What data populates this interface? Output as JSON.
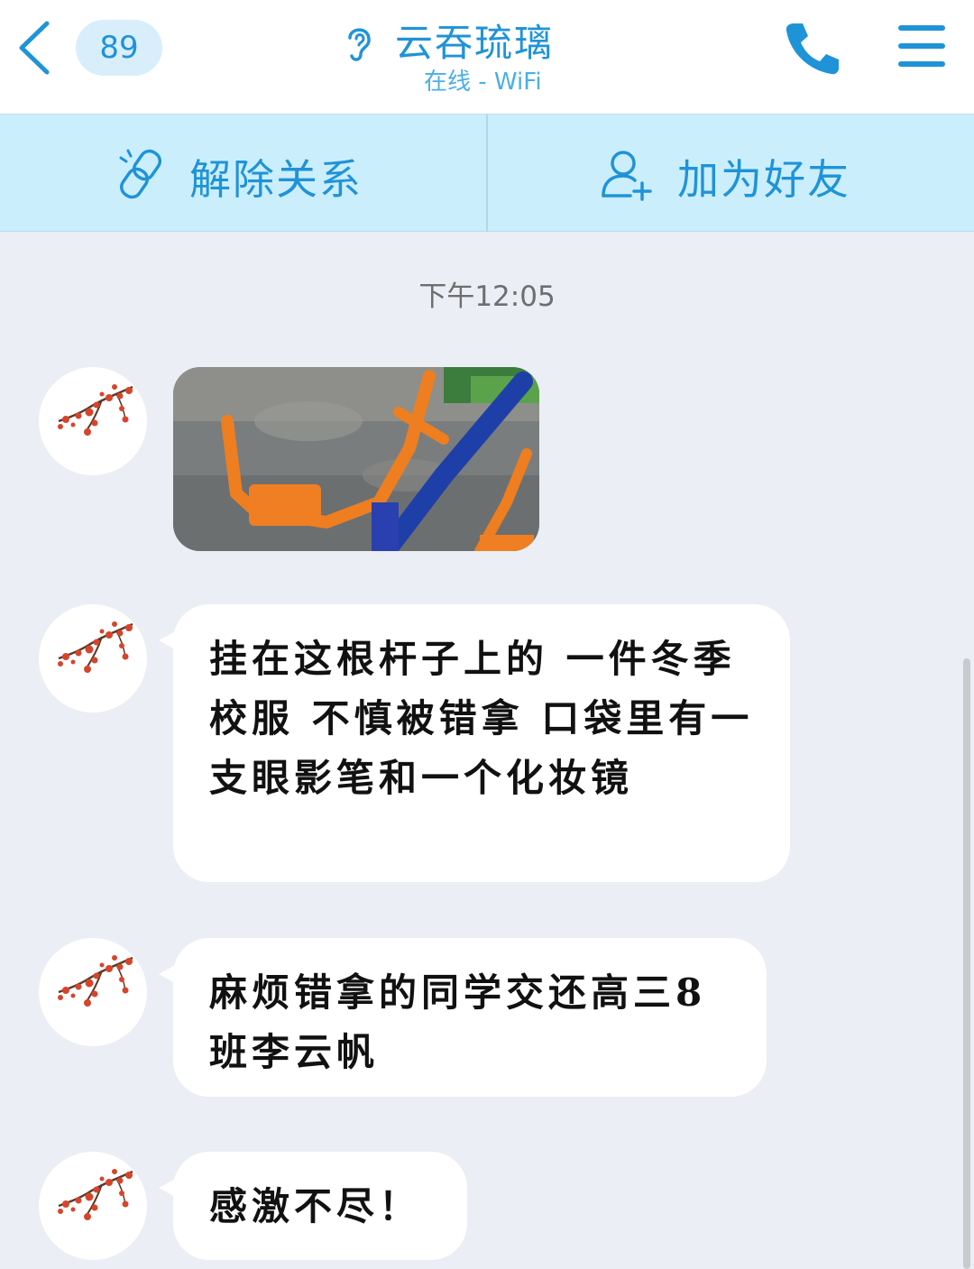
{
  "header": {
    "unread_count": "89",
    "title": "云吞琉璃",
    "status": "在线 - WiFi"
  },
  "actions": {
    "unlink_label": "解除关系",
    "add_friend_label": "加为好友"
  },
  "chat": {
    "timestamp": "下午12:05",
    "messages": [
      {
        "type": "image"
      },
      {
        "type": "text",
        "text": "挂在这根杆子上的 一件冬季校服 不慎被错拿 口袋里有一支眼影笔和一个化妆镜"
      },
      {
        "type": "text",
        "text": "麻烦错拿的同学交还高三8班李云帆"
      },
      {
        "type": "text",
        "text": "感激不尽！"
      }
    ]
  },
  "colors": {
    "accent": "#1f93d8",
    "action_bar": "#cbeefc",
    "chat_background": "#ebeef4",
    "bubble": "#ffffff"
  },
  "icons": {
    "back": "chevron-left-icon",
    "title": "ear-icon",
    "call": "phone-icon",
    "menu": "hamburger-menu-icon",
    "unlink": "broken-link-icon",
    "add_friend": "add-user-icon"
  }
}
